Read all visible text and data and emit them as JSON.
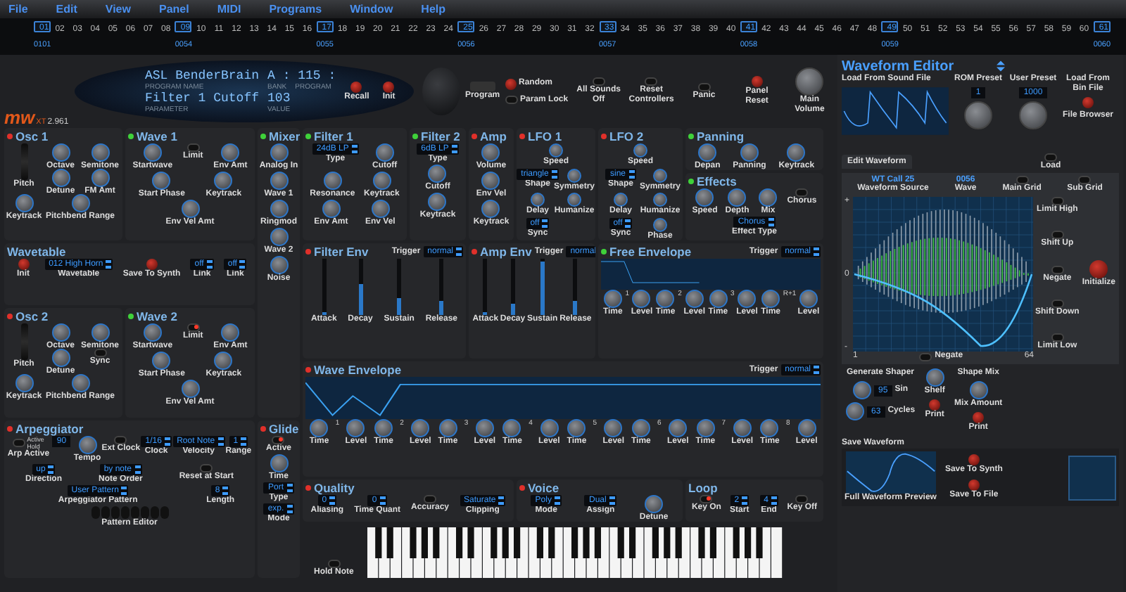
{
  "menu": [
    "File",
    "Edit",
    "View",
    "Panel",
    "MIDI",
    "Programs",
    "Window",
    "Help"
  ],
  "slots": [
    {
      "label": "01",
      "selected": true,
      "caption": "0101"
    },
    {
      "label": "02",
      "selected": false
    },
    {
      "label": "03",
      "selected": false
    },
    {
      "label": "04",
      "selected": false
    },
    {
      "label": "05",
      "selected": false
    },
    {
      "label": "06",
      "selected": false
    },
    {
      "label": "07",
      "selected": false
    },
    {
      "label": "08",
      "selected": false
    },
    {
      "label": "09",
      "selected": true,
      "caption": "0054"
    },
    {
      "label": "10",
      "selected": false
    },
    {
      "label": "11",
      "selected": false
    },
    {
      "label": "12",
      "selected": false
    },
    {
      "label": "13",
      "selected": false
    },
    {
      "label": "14",
      "selected": false
    },
    {
      "label": "15",
      "selected": false
    },
    {
      "label": "16",
      "selected": false
    },
    {
      "label": "17",
      "selected": true,
      "caption": "0055"
    },
    {
      "label": "18",
      "selected": false
    },
    {
      "label": "19",
      "selected": false
    },
    {
      "label": "20",
      "selected": false
    },
    {
      "label": "21",
      "selected": false
    },
    {
      "label": "22",
      "selected": false
    },
    {
      "label": "23",
      "selected": false
    },
    {
      "label": "24",
      "selected": false
    },
    {
      "label": "25",
      "selected": true,
      "caption": "0056"
    },
    {
      "label": "26",
      "selected": false
    },
    {
      "label": "27",
      "selected": false
    },
    {
      "label": "28",
      "selected": false
    },
    {
      "label": "29",
      "selected": false
    },
    {
      "label": "30",
      "selected": false
    },
    {
      "label": "31",
      "selected": false
    },
    {
      "label": "32",
      "selected": false
    },
    {
      "label": "33",
      "selected": true,
      "caption": "0057"
    },
    {
      "label": "34",
      "selected": false
    },
    {
      "label": "35",
      "selected": false
    },
    {
      "label": "36",
      "selected": false
    },
    {
      "label": "37",
      "selected": false
    },
    {
      "label": "38",
      "selected": false
    },
    {
      "label": "39",
      "selected": false
    },
    {
      "label": "40",
      "selected": false
    },
    {
      "label": "41",
      "selected": true,
      "caption": "0058"
    },
    {
      "label": "42",
      "selected": false
    },
    {
      "label": "43",
      "selected": false
    },
    {
      "label": "44",
      "selected": false
    },
    {
      "label": "45",
      "selected": false
    },
    {
      "label": "46",
      "selected": false
    },
    {
      "label": "47",
      "selected": false
    },
    {
      "label": "48",
      "selected": false
    },
    {
      "label": "49",
      "selected": true,
      "caption": "0059"
    },
    {
      "label": "50",
      "selected": false
    },
    {
      "label": "51",
      "selected": false
    },
    {
      "label": "52",
      "selected": false
    },
    {
      "label": "53",
      "selected": false
    },
    {
      "label": "54",
      "selected": false
    },
    {
      "label": "55",
      "selected": false
    },
    {
      "label": "56",
      "selected": false
    },
    {
      "label": "57",
      "selected": false
    },
    {
      "label": "58",
      "selected": false
    },
    {
      "label": "59",
      "selected": false
    },
    {
      "label": "60",
      "selected": false
    },
    {
      "label": "61",
      "selected": true,
      "caption": "0060"
    }
  ],
  "header": {
    "display": {
      "program_name": "ASL BenderBrain",
      "program_name_caption": "PROGRAM NAME",
      "bank_program": "A : 115 :",
      "bank_caption": "BANK",
      "program_caption": "PROGRAM",
      "parameter": "Filter 1 Cutoff",
      "parameter_caption": "PARAMETER",
      "value": "103",
      "value_caption": "VALUE"
    },
    "display_buttons": [
      "Recall",
      "Init"
    ],
    "program": "Program",
    "random": "Random",
    "param_lock": "Param Lock",
    "global_controls": [
      {
        "kind": "switch",
        "label": "All Sounds Off",
        "on": false
      },
      {
        "kind": "switch",
        "label": "Reset Controllers",
        "on": false
      },
      {
        "kind": "switch",
        "label": "Panic",
        "on": false
      },
      {
        "kind": "button",
        "label": "Panel Reset"
      },
      {
        "kind": "knob",
        "label": "Main Volume"
      }
    ],
    "logo": {
      "mark": "mw",
      "edition": "XT",
      "version": "2.961"
    }
  },
  "sections": [
    {
      "title": "Osc 1",
      "enabled": false,
      "controls": [
        {
          "kind": "wheel",
          "label": "Pitch"
        },
        {
          "kind": "knob",
          "label": "Octave"
        },
        {
          "kind": "knob",
          "label": "Semitone"
        },
        {
          "kind": "knob",
          "label": "Detune"
        },
        {
          "kind": "knob",
          "label": "FM Amt"
        },
        {
          "kind": "knob",
          "label": "Keytrack"
        },
        {
          "kind": "knob",
          "label": "Pitchbend Range"
        }
      ]
    },
    {
      "title": "Wave 1",
      "enabled": true,
      "controls": [
        {
          "kind": "knob",
          "label": "Startwave"
        },
        {
          "kind": "switch",
          "label": "Limit",
          "on": false
        },
        {
          "kind": "knob",
          "label": "Env Amt"
        },
        {
          "kind": "knob",
          "label": "Start Phase"
        },
        {
          "kind": "knob",
          "label": "Keytrack"
        },
        {
          "kind": "knob",
          "label": "Env Vel Amt"
        }
      ]
    },
    {
      "title": "Wavetable",
      "controls": [
        {
          "kind": "button",
          "label": "Init"
        },
        {
          "kind": "select",
          "value": "012 High Horn",
          "label": "Wavetable"
        },
        {
          "kind": "button",
          "label": "Save To Synth"
        },
        {
          "kind": "select",
          "value": "off",
          "label": "Link"
        },
        {
          "kind": "select",
          "value": "off",
          "label": "Link"
        }
      ]
    },
    {
      "title": "Osc 2",
      "enabled": false,
      "controls": [
        {
          "kind": "wheel",
          "label": "Pitch"
        },
        {
          "kind": "knob",
          "label": "Octave"
        },
        {
          "kind": "knob",
          "label": "Semitone"
        },
        {
          "kind": "knob",
          "label": "Detune"
        },
        {
          "kind": "switch",
          "label": "Sync",
          "on": false
        },
        {
          "kind": "knob",
          "label": "Keytrack"
        },
        {
          "kind": "knob",
          "label": "Pitchbend Range"
        }
      ]
    },
    {
      "title": "Wave 2",
      "enabled": true,
      "controls": [
        {
          "kind": "knob",
          "label": "Startwave"
        },
        {
          "kind": "switch",
          "label": "Limit",
          "on": true
        },
        {
          "kind": "knob",
          "label": "Env Amt"
        },
        {
          "kind": "knob",
          "label": "Start Phase"
        },
        {
          "kind": "knob",
          "label": "Keytrack"
        },
        {
          "kind": "knob",
          "label": "Env Vel Amt"
        }
      ]
    },
    {
      "title": "Mixer",
      "enabled": true,
      "controls": [
        {
          "kind": "knob",
          "label": "Analog In"
        },
        {
          "kind": "knob",
          "label": "Wave 1"
        },
        {
          "kind": "knob",
          "label": "Ringmod"
        },
        {
          "kind": "knob",
          "label": "Wave 2"
        },
        {
          "kind": "knob",
          "label": "Noise"
        }
      ]
    },
    {
      "title": "Filter 1",
      "enabled": true,
      "controls": [
        {
          "kind": "select",
          "value": "24dB LP",
          "label": "Type"
        },
        {
          "kind": "knob",
          "label": "Cutoff"
        },
        {
          "kind": "knob",
          "label": "Resonance"
        },
        {
          "kind": "knob",
          "label": "Keytrack"
        },
        {
          "kind": "knob",
          "label": "Env Amt"
        },
        {
          "kind": "knob",
          "label": "Env Vel"
        }
      ]
    },
    {
      "title": "Filter 2",
      "enabled": true,
      "controls": [
        {
          "kind": "select",
          "value": "6dB LP",
          "label": "Type"
        },
        {
          "kind": "knob",
          "label": "Cutoff"
        },
        {
          "kind": "knob",
          "label": "Keytrack"
        }
      ]
    },
    {
      "title": "Amp",
      "enabled": false,
      "controls": [
        {
          "kind": "knob",
          "label": "Volume"
        },
        {
          "kind": "knob",
          "label": "Env Vel"
        },
        {
          "kind": "knob",
          "label": "Keytrack"
        }
      ]
    },
    {
      "title": "LFO 1",
      "enabled": false,
      "controls": [
        {
          "kind": "knob",
          "label": "Speed"
        },
        {
          "kind": "select",
          "value": "triangle",
          "label": "Shape"
        },
        {
          "kind": "knob",
          "label": "Symmetry"
        },
        {
          "kind": "knob",
          "label": "Delay"
        },
        {
          "kind": "knob",
          "label": "Humanize"
        },
        {
          "kind": "select",
          "value": "off",
          "label": "Sync"
        }
      ]
    },
    {
      "title": "LFO 2",
      "enabled": false,
      "controls": [
        {
          "kind": "knob",
          "label": "Speed"
        },
        {
          "kind": "select",
          "value": "sine",
          "label": "Shape"
        },
        {
          "kind": "knob",
          "label": "Symmetry"
        },
        {
          "kind": "knob",
          "label": "Delay"
        },
        {
          "kind": "knob",
          "label": "Humanize"
        },
        {
          "kind": "select",
          "value": "off",
          "label": "Sync"
        },
        {
          "kind": "knob",
          "label": "Phase"
        }
      ]
    },
    {
      "title": "Panning",
      "enabled": true,
      "controls": [
        {
          "kind": "knob",
          "label": "Depan"
        },
        {
          "kind": "knob",
          "label": "Panning"
        },
        {
          "kind": "knob",
          "label": "Keytrack"
        }
      ]
    },
    {
      "title": "Effects",
      "enabled": true,
      "controls": [
        {
          "kind": "knob",
          "label": "Speed"
        },
        {
          "kind": "knob",
          "label": "Depth"
        },
        {
          "kind": "knob",
          "label": "Mix"
        },
        {
          "kind": "switch",
          "label": "Chorus",
          "on": false
        },
        {
          "kind": "select",
          "value": "Chorus",
          "label": "Effect Type"
        }
      ]
    },
    {
      "title": "Filter Env",
      "enabled": false,
      "trigger": {
        "label": "Trigger",
        "value": "normal"
      },
      "controls": [
        {
          "kind": "slider",
          "label": "Attack",
          "level": 0.05
        },
        {
          "kind": "slider",
          "label": "Decay",
          "level": 0.55
        },
        {
          "kind": "slider",
          "label": "Sustain",
          "level": 0.3
        },
        {
          "kind": "slider",
          "label": "Release",
          "level": 0.25
        }
      ]
    },
    {
      "title": "Amp Env",
      "enabled": false,
      "trigger": {
        "label": "Trigger",
        "value": "normal"
      },
      "controls": [
        {
          "kind": "slider",
          "label": "Attack",
          "level": 0.05
        },
        {
          "kind": "slider",
          "label": "Decay",
          "level": 0.2
        },
        {
          "kind": "slider",
          "label": "Sustain",
          "level": 0.95
        },
        {
          "kind": "slider",
          "label": "Release",
          "level": 0.25
        }
      ]
    },
    {
      "title": "Free Envelope",
      "enabled": true,
      "trigger": {
        "label": "Trigger",
        "value": "normal"
      },
      "controls": [
        {
          "kind": "knob",
          "label": "Time"
        },
        {
          "kind": "tag",
          "label": "1"
        },
        {
          "kind": "knob",
          "label": "Level"
        },
        {
          "kind": "knob",
          "label": "Time"
        },
        {
          "kind": "tag",
          "label": "2"
        },
        {
          "kind": "knob",
          "label": "Level"
        },
        {
          "kind": "knob",
          "label": "Time"
        },
        {
          "kind": "tag",
          "label": "3"
        },
        {
          "kind": "knob",
          "label": "Level"
        },
        {
          "kind": "knob",
          "label": "Time"
        },
        {
          "kind": "tag",
          "label": "R+1"
        },
        {
          "kind": "knob",
          "label": "Level"
        }
      ]
    },
    {
      "title": "Wave Envelope",
      "enabled": false,
      "trigger": {
        "label": "Trigger",
        "value": "normal"
      },
      "controls": [
        {
          "kind": "knob",
          "label": "Time"
        },
        {
          "kind": "tag",
          "label": "1"
        },
        {
          "kind": "knob",
          "label": "Level"
        },
        {
          "kind": "knob",
          "label": "Time"
        },
        {
          "kind": "tag",
          "label": "2"
        },
        {
          "kind": "knob",
          "label": "Level"
        },
        {
          "kind": "knob",
          "label": "Time"
        },
        {
          "kind": "tag",
          "label": "3"
        },
        {
          "kind": "knob",
          "label": "Level"
        },
        {
          "kind": "knob",
          "label": "Time"
        },
        {
          "kind": "tag",
          "label": "4"
        },
        {
          "kind": "knob",
          "label": "Level"
        },
        {
          "kind": "knob",
          "label": "Time"
        },
        {
          "kind": "tag",
          "label": "5"
        },
        {
          "kind": "knob",
          "label": "Level"
        },
        {
          "kind": "knob",
          "label": "Time"
        },
        {
          "kind": "tag",
          "label": "6"
        },
        {
          "kind": "knob",
          "label": "Level"
        },
        {
          "kind": "knob",
          "label": "Time"
        },
        {
          "kind": "tag",
          "label": "7"
        },
        {
          "kind": "knob",
          "label": "Level"
        },
        {
          "kind": "knob",
          "label": "Time"
        },
        {
          "kind": "tag",
          "label": "8"
        },
        {
          "kind": "knob",
          "label": "Level"
        }
      ]
    },
    {
      "title": "Arpeggiator",
      "enabled": false,
      "controls": [
        {
          "kind": "switch",
          "label": "Arp Active",
          "options": [
            "Active",
            "Hold"
          ],
          "on": false
        },
        {
          "kind": "number",
          "value": "90"
        },
        {
          "kind": "knob",
          "label": "Tempo"
        },
        {
          "kind": "switch",
          "label": "Ext Clock",
          "on": false
        },
        {
          "kind": "select",
          "value": "1/16",
          "label": "Clock"
        },
        {
          "kind": "select",
          "value": "Root Note",
          "label": "Velocity"
        },
        {
          "kind": "select",
          "value": "1",
          "label": "Range"
        },
        {
          "kind": "select",
          "value": "up",
          "label": "Direction"
        },
        {
          "kind": "select",
          "value": "by note",
          "label": "Note Order"
        },
        {
          "kind": "switch",
          "label": "Reset at Start",
          "on": false
        },
        {
          "kind": "select",
          "value": "User Pattern",
          "label": "Arpeggiator Pattern"
        },
        {
          "kind": "select",
          "value": "8",
          "label": "Length"
        },
        {
          "kind": "pattern",
          "label": "Pattern Editor"
        }
      ]
    },
    {
      "title": "Glide",
      "enabled": false,
      "controls": [
        {
          "kind": "switch",
          "label": "Active",
          "on": true
        },
        {
          "kind": "knob",
          "label": "Time"
        },
        {
          "kind": "select",
          "value": "Port",
          "label": "Type"
        },
        {
          "kind": "select",
          "value": "exp.",
          "label": "Mode"
        }
      ]
    },
    {
      "title": "Quality",
      "enabled": false,
      "controls": [
        {
          "kind": "select",
          "value": "0",
          "label": "Aliasing"
        },
        {
          "kind": "select",
          "value": "0",
          "label": "Time Quant"
        },
        {
          "kind": "switch",
          "label": "Accuracy",
          "on": false
        },
        {
          "kind": "select",
          "value": "Saturate",
          "label": "Clipping"
        }
      ]
    },
    {
      "title": "Voice",
      "enabled": false,
      "controls": [
        {
          "kind": "select",
          "value": "Poly",
          "label": "Mode"
        },
        {
          "kind": "select",
          "value": "Dual",
          "label": "Assign"
        },
        {
          "kind": "knob",
          "label": "Detune"
        }
      ]
    },
    {
      "title": "Loop",
      "controls": [
        {
          "kind": "switch",
          "label": "Key On",
          "on": true
        },
        {
          "kind": "select",
          "value": "2",
          "label": "Start"
        },
        {
          "kind": "select",
          "value": "4",
          "label": "End"
        },
        {
          "kind": "switch",
          "label": "Key Off",
          "on": false
        }
      ]
    }
  ],
  "keyboard": {
    "hold_note": "Hold Note"
  },
  "waveform_editor": {
    "title": "Waveform Editor",
    "load_from_sound_file": "Load From Sound File",
    "rom_preset": {
      "label": "ROM Preset",
      "value": "1"
    },
    "user_preset": {
      "label": "User Preset",
      "value": "1000"
    },
    "load_from_bin_file": "Load From Bin File",
    "file_browser": "File Browser",
    "load": "Load",
    "tab": {
      "label": "Edit Waveform",
      "selected": true
    },
    "waveform_source": {
      "value": "WT Call 25",
      "label": "Waveform Source"
    },
    "wave": {
      "value": "0056",
      "label": "Wave"
    },
    "main_grid": "Main Grid",
    "sub_grid": "Sub Grid",
    "side_buttons": [
      "Limit High",
      "Shift Up",
      "Negate",
      "Shift Down",
      "Limit Low"
    ],
    "initialize": "Initialize",
    "axis": {
      "plus": "+",
      "zero": "0",
      "minus": "-",
      "start": "1",
      "end": "64"
    },
    "negate_bottom": "Negate",
    "generate_shaper": {
      "title": "Generate Shaper",
      "sin": {
        "label": "Sin",
        "value": "95"
      },
      "cycles": {
        "label": "Cycles",
        "value": "63"
      },
      "shelf": "Shelf",
      "print": "Print"
    },
    "shape_mix": {
      "title": "Shape Mix",
      "mix_amount": "Mix Amount",
      "print": "Print"
    },
    "save_waveform": {
      "title": "Save Waveform",
      "preview": "Full Waveform Preview",
      "save_to_synth": "Save To Synth",
      "save_to_file": "Save To File"
    }
  }
}
